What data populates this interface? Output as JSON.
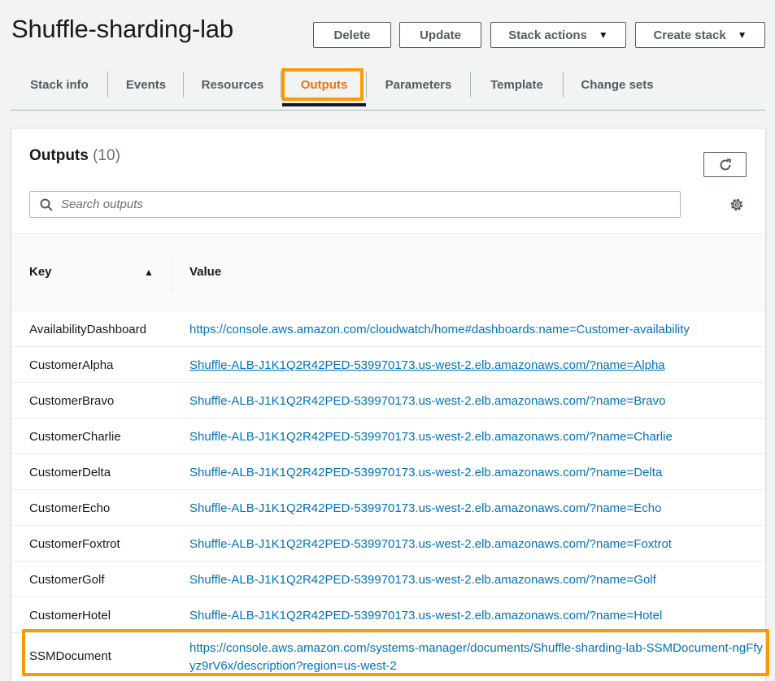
{
  "header": {
    "title": "Shuffle-sharding-lab",
    "buttons": {
      "delete": "Delete",
      "update": "Update",
      "stack_actions": "Stack actions",
      "create_stack": "Create stack"
    }
  },
  "tabs": [
    {
      "label": "Stack info"
    },
    {
      "label": "Events"
    },
    {
      "label": "Resources"
    },
    {
      "label": "Outputs",
      "active": true
    },
    {
      "label": "Parameters"
    },
    {
      "label": "Template"
    },
    {
      "label": "Change sets"
    }
  ],
  "outputs": {
    "title": "Outputs",
    "count": "(10)",
    "search_placeholder": "Search outputs",
    "columns": {
      "key": "Key",
      "value": "Value"
    },
    "rows": [
      {
        "key": "AvailabilityDashboard",
        "value": "https://console.aws.amazon.com/cloudwatch/home#dashboards:name=Customer-availability"
      },
      {
        "key": "CustomerAlpha",
        "value": "Shuffle-ALB-J1K1Q2R42PED-539970173.us-west-2.elb.amazonaws.com/?name=Alpha"
      },
      {
        "key": "CustomerBravo",
        "value": "Shuffle-ALB-J1K1Q2R42PED-539970173.us-west-2.elb.amazonaws.com/?name=Bravo"
      },
      {
        "key": "CustomerCharlie",
        "value": "Shuffle-ALB-J1K1Q2R42PED-539970173.us-west-2.elb.amazonaws.com/?name=Charlie"
      },
      {
        "key": "CustomerDelta",
        "value": "Shuffle-ALB-J1K1Q2R42PED-539970173.us-west-2.elb.amazonaws.com/?name=Delta"
      },
      {
        "key": "CustomerEcho",
        "value": "Shuffle-ALB-J1K1Q2R42PED-539970173.us-west-2.elb.amazonaws.com/?name=Echo"
      },
      {
        "key": "CustomerFoxtrot",
        "value": "Shuffle-ALB-J1K1Q2R42PED-539970173.us-west-2.elb.amazonaws.com/?name=Foxtrot"
      },
      {
        "key": "CustomerGolf",
        "value": "Shuffle-ALB-J1K1Q2R42PED-539970173.us-west-2.elb.amazonaws.com/?name=Golf"
      },
      {
        "key": "CustomerHotel",
        "value": "Shuffle-ALB-J1K1Q2R42PED-539970173.us-west-2.elb.amazonaws.com/?name=Hotel"
      },
      {
        "key": "SSMDocument",
        "value": "https://console.aws.amazon.com/systems-manager/documents/Shuffle-sharding-lab-SSMDocument-ngFfyyz9rV6x/description?region=us-west-2"
      }
    ]
  },
  "colors": {
    "link": "#0073bb",
    "active_tab": "#ec7211",
    "highlight": "#ff9900"
  }
}
